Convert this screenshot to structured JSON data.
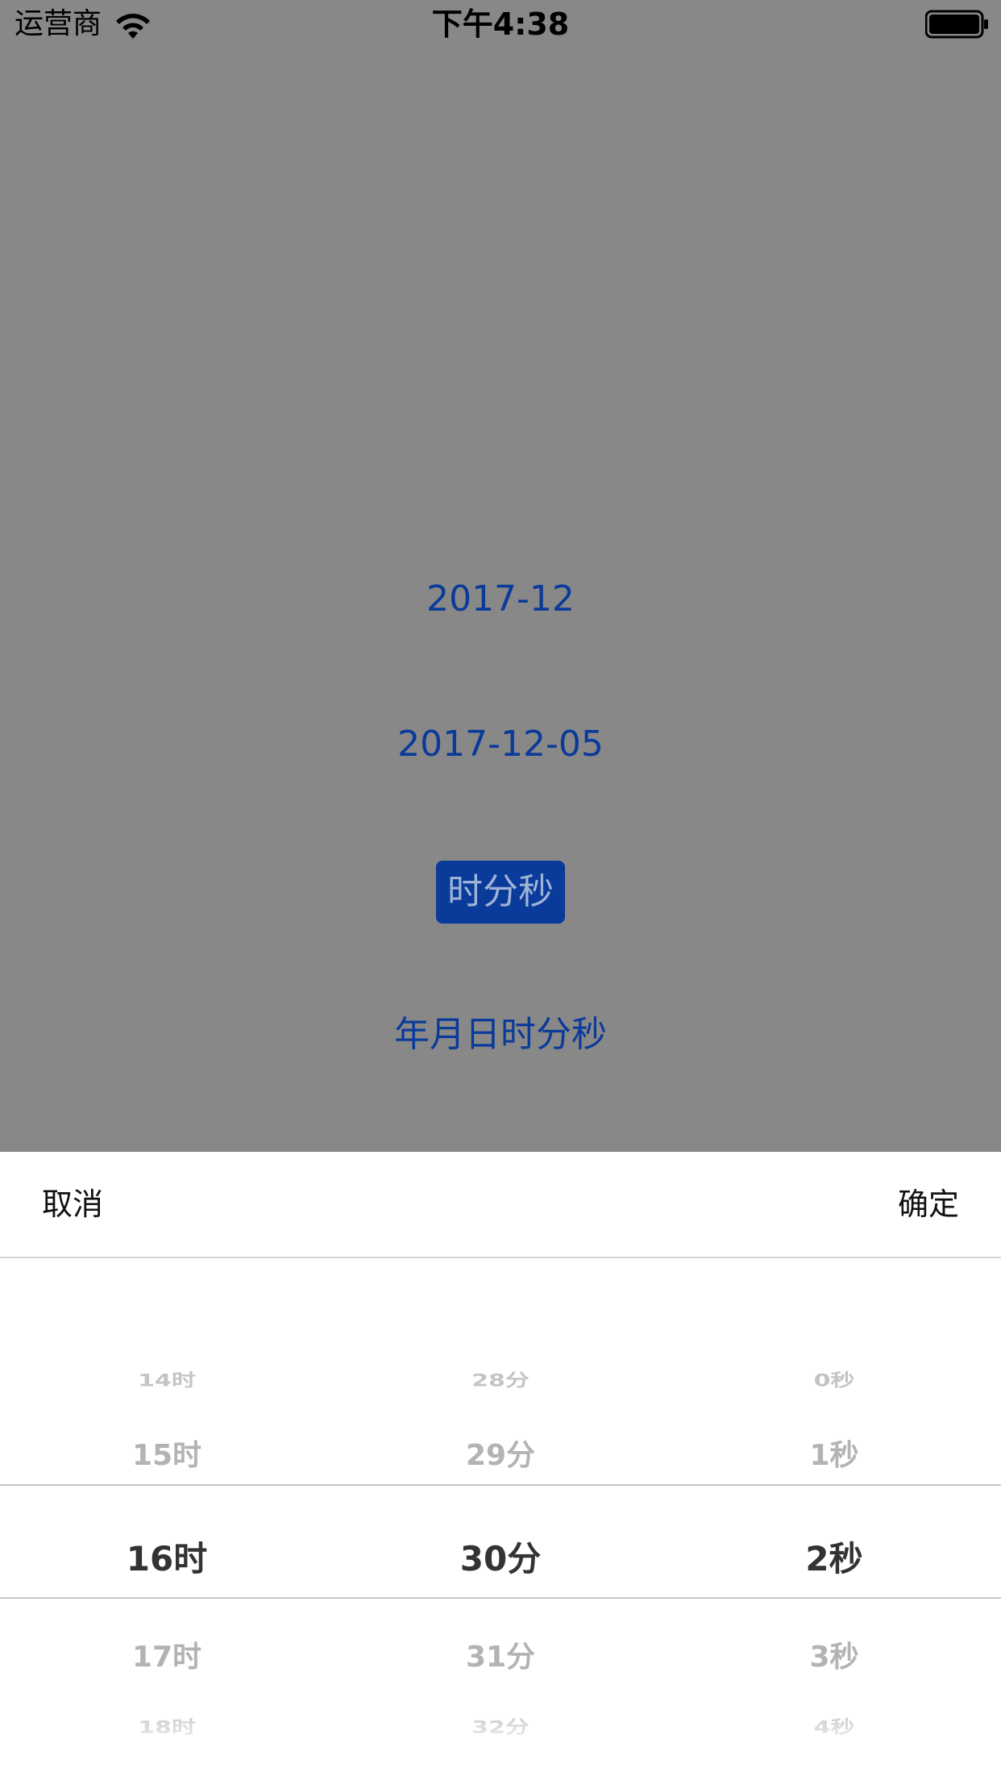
{
  "status_bar": {
    "carrier": "运营商",
    "time": "下午4:38"
  },
  "demo_buttons": [
    {
      "label": "2017-12",
      "selected": false
    },
    {
      "label": "2017-12-05",
      "selected": false
    },
    {
      "label": "时分秒",
      "selected": true
    },
    {
      "label": "年月日时分秒",
      "selected": false
    }
  ],
  "picker": {
    "cancel_label": "取消",
    "confirm_label": "确定",
    "hours": {
      "prev2": "14时",
      "prev1": "15时",
      "selected": "16时",
      "next1": "17时",
      "next2": "18时"
    },
    "minutes": {
      "prev2": "28分",
      "prev1": "29分",
      "selected": "30分",
      "next1": "31分",
      "next2": "32分"
    },
    "seconds": {
      "prev2": "0秒",
      "prev1": "1秒",
      "selected": "2秒",
      "next1": "3秒",
      "next2": "4秒"
    }
  },
  "colors": {
    "overlay_dim": "#888888",
    "accent_blue": "#0a3a9a",
    "sheet_bg": "#ffffff"
  }
}
